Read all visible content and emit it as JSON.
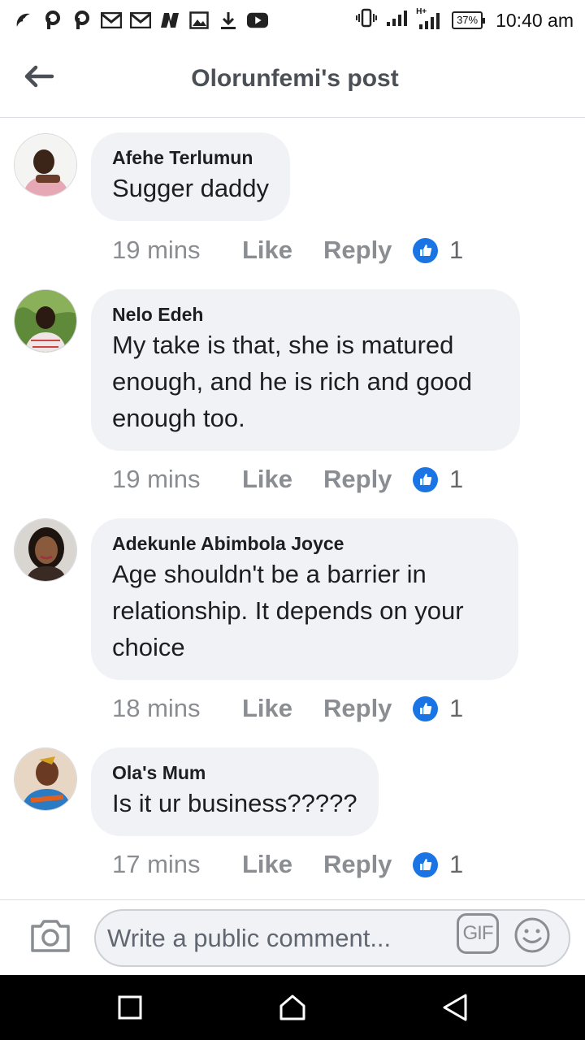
{
  "status_bar": {
    "time": "10:40 am",
    "battery": "37%",
    "network_label": "H+",
    "notification_icons": [
      "opera-icon",
      "p-icon",
      "p-icon",
      "gmail-icon",
      "gmail-icon",
      "n-icon",
      "image-icon",
      "download-icon",
      "youtube-icon"
    ]
  },
  "header": {
    "title": "Olorunfemi's post"
  },
  "comments": [
    {
      "author": "Afehe Terlumun",
      "text": "Sugger daddy",
      "time": "19 mins",
      "like_label": "Like",
      "reply_label": "Reply",
      "reactions": "1"
    },
    {
      "author": "Nelo Edeh",
      "text_lines": [
        "My take is that, she is matured",
        "enough, and he is rich and good",
        "enough too."
      ],
      "time": "19 mins",
      "like_label": "Like",
      "reply_label": "Reply",
      "reactions": "1"
    },
    {
      "author": "Adekunle Abimbola Joyce",
      "text_lines": [
        "Age shouldn't be a barrier in",
        "relationship. It depends on your",
        "choice"
      ],
      "time": "18 mins",
      "like_label": "Like",
      "reply_label": "Reply",
      "reactions": "1"
    },
    {
      "author": "Ola's Mum",
      "text": "Is it ur business?????",
      "time": "17 mins",
      "like_label": "Like",
      "reply_label": "Reply",
      "reactions": "1"
    }
  ],
  "composer": {
    "placeholder": "Write a public comment...",
    "gif_label": "GIF"
  },
  "colors": {
    "bubble_bg": "#f0f2f5",
    "meta_text": "#8a8d91",
    "like_blue": "#1b74e4",
    "header_text": "#4b4f56"
  }
}
